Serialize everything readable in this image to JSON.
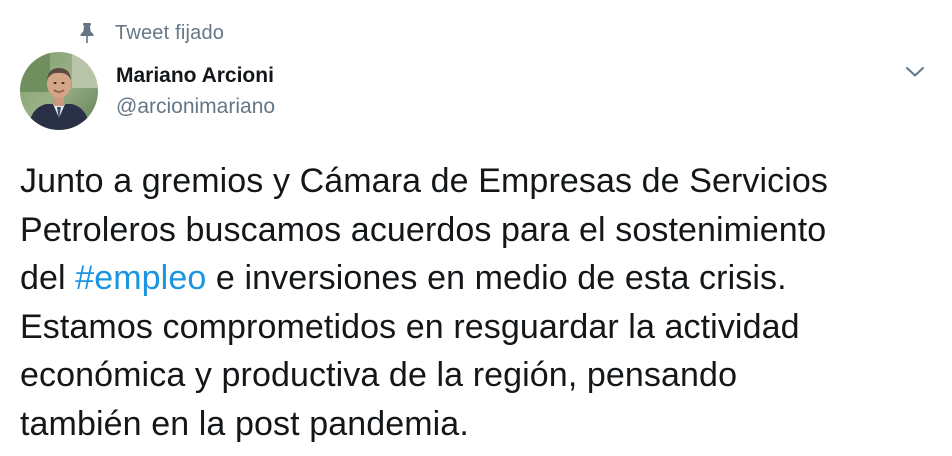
{
  "pinned": {
    "label": "Tweet fijado",
    "icon": "pin-icon"
  },
  "author": {
    "name": "Mariano Arcioni",
    "handle": "@arcionimariano",
    "avatar_icon": "avatar"
  },
  "menu": {
    "icon": "chevron-down-icon"
  },
  "tweet": {
    "line1": "Junto a gremios y Cámara de Empresas de Servicios",
    "line2": "Petroleros buscamos acuerdos para el sostenimiento",
    "line3_prefix": "del ",
    "hashtag": "#empleo",
    "line3_suffix": " e inversiones en medio de esta crisis.",
    "line4": "Estamos comprometidos en resguardar la actividad",
    "line5": "económica y productiva de la región, pensando",
    "line6": "también en la post pandemia."
  },
  "colors": {
    "text": "#14171a",
    "secondary": "#657786",
    "link": "#1b95e0",
    "background": "#ffffff"
  }
}
